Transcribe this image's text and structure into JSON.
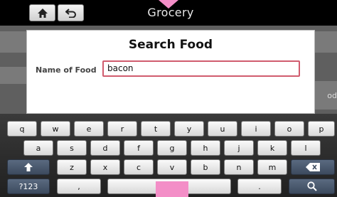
{
  "titlebar": {
    "title": "Grocery",
    "home_icon": "home-icon",
    "back_icon": "back-arrow-icon"
  },
  "background": {
    "partial_text": "od"
  },
  "dialog": {
    "title": "Search Food",
    "field_label": "Name of Food",
    "field_value": "bacon"
  },
  "keyboard": {
    "row1": [
      "q",
      "w",
      "e",
      "r",
      "t",
      "y",
      "u",
      "i",
      "o",
      "p"
    ],
    "row2": [
      "a",
      "s",
      "d",
      "f",
      "g",
      "h",
      "j",
      "k",
      "l"
    ],
    "row3": [
      "z",
      "x",
      "c",
      "v",
      "b",
      "n",
      "m"
    ],
    "shift_icon": "shift-arrow-icon",
    "backspace_icon": "backspace-icon",
    "sym_label": "?123",
    "comma_label": ",",
    "period_label": ".",
    "search_icon": "search-icon"
  },
  "colors": {
    "accent_pink": "#f38ec7",
    "input_border": "#d05c6e",
    "special_key": "#4a5a70"
  }
}
